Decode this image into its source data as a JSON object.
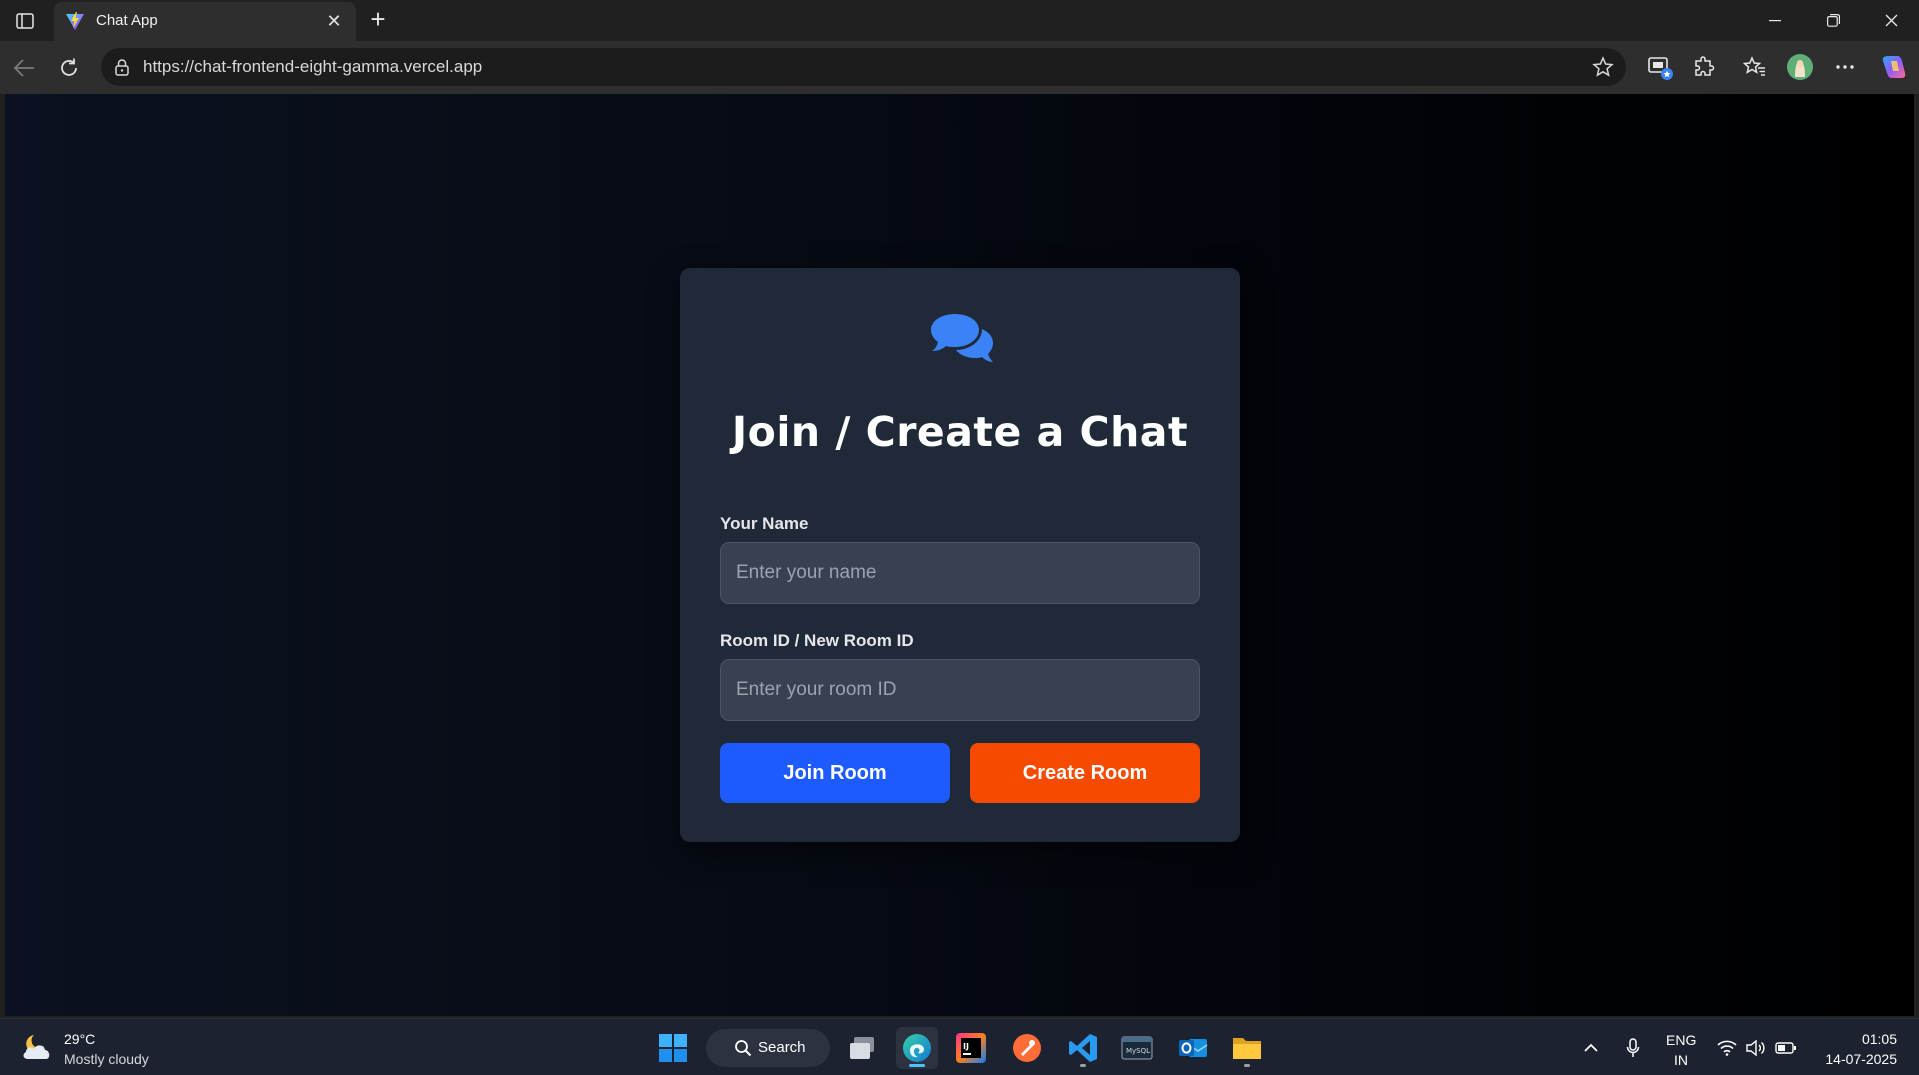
{
  "browser": {
    "tab": {
      "title": "Chat App",
      "favicon": "vite-icon",
      "close_glyph": "✕"
    },
    "new_tab_glyph": "+",
    "address": {
      "url": "https://chat-frontend-eight-gamma.vercel.app"
    },
    "window_controls": [
      "minimize-icon",
      "restore-icon",
      "close-icon"
    ],
    "toolbar_icons": [
      "collections-icon",
      "extensions-icon",
      "favorites-icon",
      "profile-avatar",
      "more-icon",
      "copilot-icon"
    ]
  },
  "page": {
    "icon": "chat-bubbles-icon",
    "accent": "#3b82f6",
    "title": "Join / Create a Chat",
    "name_field": {
      "label": "Your Name",
      "placeholder": "Enter your name",
      "value": ""
    },
    "room_field": {
      "label": "Room ID / New Room ID",
      "placeholder": "Enter your room ID",
      "value": ""
    },
    "join_button": {
      "label": "Join Room",
      "color": "#1d5bff"
    },
    "create_button": {
      "label": "Create Room",
      "color": "#f54a00"
    }
  },
  "taskbar": {
    "weather": {
      "temp": "29°C",
      "desc": "Mostly cloudy",
      "icon": "partly-cloudy-night-icon"
    },
    "search_label": "Search",
    "apps": [
      "start-icon",
      "task-view-icon",
      "edge-icon",
      "intellij-icon",
      "postman-icon",
      "vscode-icon",
      "mysql-icon",
      "outlook-icon",
      "file-explorer-icon"
    ],
    "tray": {
      "lang_line1": "ENG",
      "lang_line2": "IN",
      "time": "01:05",
      "date": "14-07-2025"
    }
  }
}
